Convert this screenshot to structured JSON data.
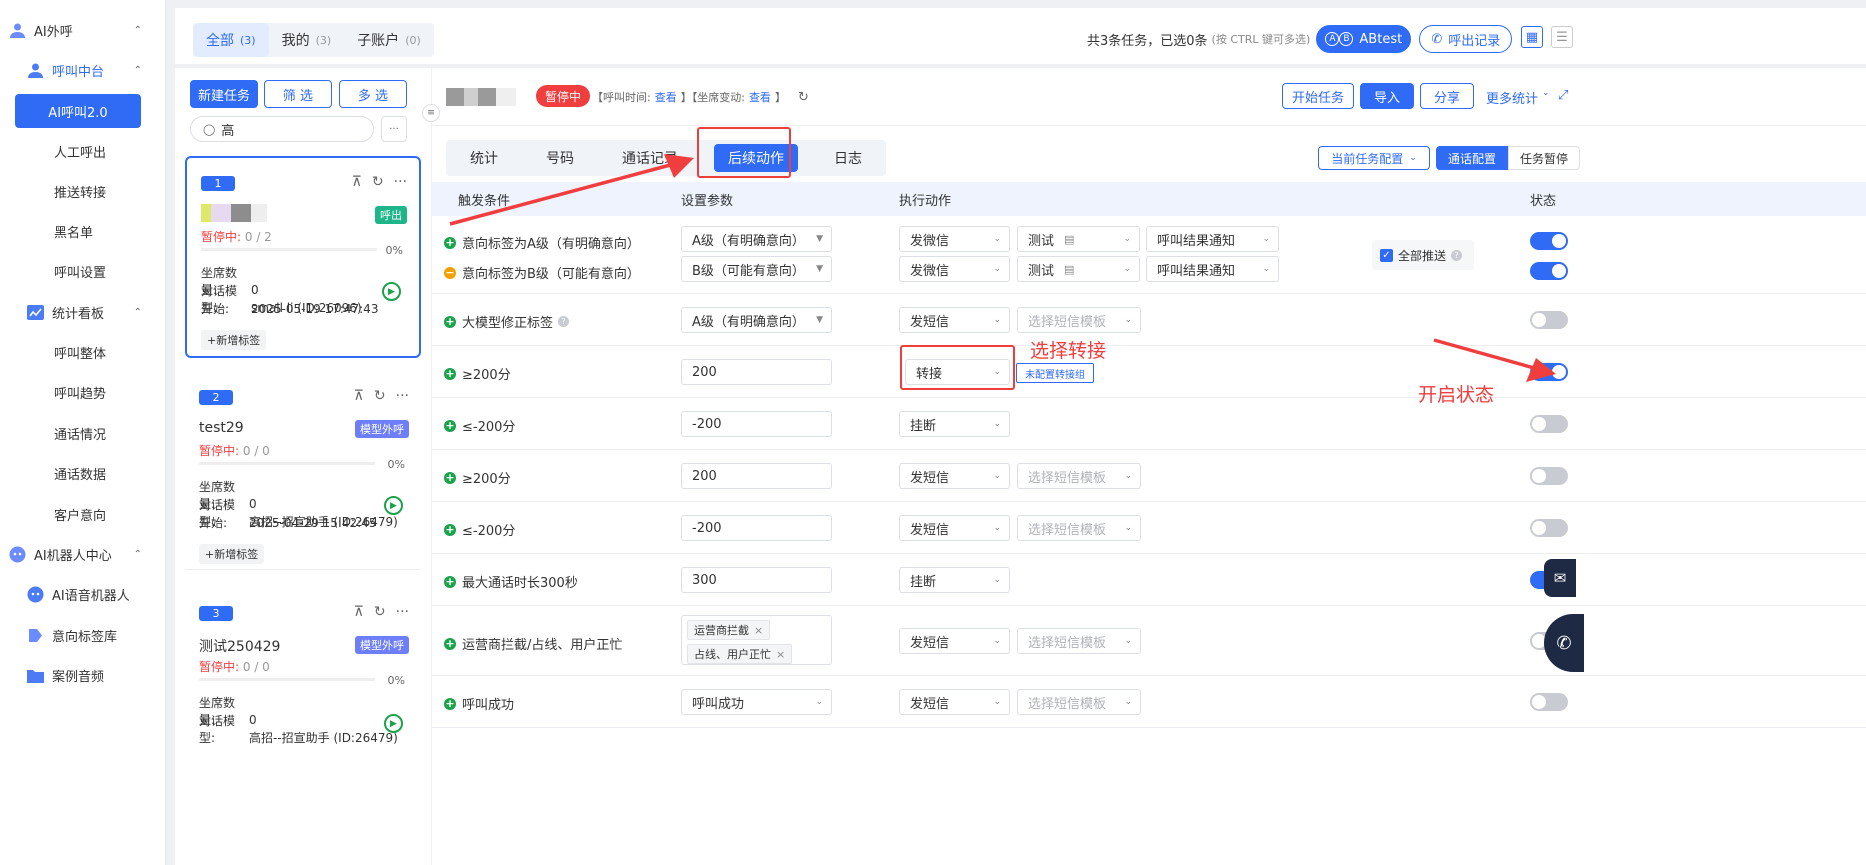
{
  "sidebar": {
    "ai_outbound": "AI外呼",
    "call_center": "呼叫中台",
    "ai_call": "AI呼叫2.0",
    "manual_call": "人工呼出",
    "push_transfer": "推送转接",
    "blacklist": "黑名单",
    "call_settings": "呼叫设置",
    "stats_board": "统计看板",
    "call_overall": "呼叫整体",
    "call_trend": "呼叫趋势",
    "call_status": "通话情况",
    "call_data": "通话数据",
    "customer_intent": "客户意向",
    "robot_center": "AI机器人中心",
    "voice_robot": "AI语音机器人",
    "intent_lib": "意向标签库",
    "case_audio": "案例音频"
  },
  "top_tabs": [
    {
      "label": "全部",
      "count": "(3)"
    },
    {
      "label": "我的",
      "count": "(3)"
    },
    {
      "label": "子账户",
      "count": "(0)"
    }
  ],
  "top_info": {
    "summary": "共3条任务，已选0条",
    "hint": "(按 CTRL 键可多选)",
    "abtest": "ABtest",
    "ab_a": "A",
    "ab_b": "B",
    "call_records": "呼出记录"
  },
  "left_toolbar": {
    "new_task": "新建任务",
    "filter": "筛 选",
    "multi": "多 选",
    "search_value": "高",
    "more": "···"
  },
  "cards": [
    {
      "num": "1",
      "title": "",
      "tag": "呼出",
      "status_paused": "暂停中:",
      "status_count": "0 / 2",
      "pct": "0%",
      "seats_label": "坐席数量:",
      "seats": "0",
      "model_label": "对话模型:",
      "model": "small li (ID:26096)",
      "start_label": "开始:",
      "start": "2025-05-19 17:47:43",
      "add_tag": "+新增标签"
    },
    {
      "num": "2",
      "title": "test29",
      "tag": "模型外呼",
      "status_paused": "暂停中:",
      "status_count": "0 / 0",
      "pct": "0%",
      "seats_label": "坐席数量:",
      "seats": "0",
      "model_label": "对话模型:",
      "model": "高招--招宣助手 (ID:26479)",
      "start_label": "开始:",
      "start": "2025-04-29 15:42:45",
      "add_tag": "+新增标签"
    },
    {
      "num": "3",
      "title": "测试250429",
      "tag": "模型外呼",
      "status_paused": "暂停中:",
      "status_count": "0 / 0",
      "pct": "0%",
      "seats_label": "坐席数量:",
      "seats": "0",
      "model_label": "对话模型:",
      "model": "高招--招宣助手 (ID:26479)"
    }
  ],
  "header": {
    "status": "暂停中",
    "call_time_label": "【呼叫时间:",
    "view1": "查看",
    "seat_change_label": "】【坐席变动:",
    "view2": "查看",
    "close": "】",
    "start_task": "开始任务",
    "import": "导入",
    "share": "分享",
    "more_stats": "更多统计"
  },
  "sub_tabs": [
    "统计",
    "号码",
    "通话记录",
    "后续动作",
    "日志"
  ],
  "config": {
    "current": "当前任务配置",
    "call_cfg": "通话配置",
    "pause_cfg": "任务暂停"
  },
  "table_head": {
    "trigger": "触发条件",
    "params": "设置参数",
    "action": "执行动作",
    "status": "状态"
  },
  "rows": [
    {
      "conds": [
        "意向标签为A级（有明确意向）",
        "意向标签为B级（可能有意向）"
      ],
      "params": [
        "A级（有明确意向）",
        "B级（可能有意向）"
      ],
      "actions": [
        "发微信",
        "发微信"
      ],
      "sub1": [
        "测试",
        "测试"
      ],
      "sub2": [
        "呼叫结果通知",
        "呼叫结果通知"
      ],
      "push_all": "全部推送"
    },
    {
      "cond": "大模型修正标签",
      "param": "A级（有明确意向）",
      "action": "发短信",
      "template": "选择短信模板"
    },
    {
      "cond": "≥200分",
      "param": "200",
      "action": "转接",
      "transfer": "未配置转接组"
    },
    {
      "cond": "≤-200分",
      "param": "-200",
      "action": "挂断"
    },
    {
      "cond": "≥200分",
      "param": "200",
      "action": "发短信",
      "template": "选择短信模板"
    },
    {
      "cond": "≤-200分",
      "param": "-200",
      "action": "发短信",
      "template": "选择短信模板"
    },
    {
      "cond": "最大通话时长300秒",
      "param": "300",
      "action": "挂断"
    },
    {
      "cond": "运营商拦截/占线、用户正忙",
      "chips": [
        "运营商拦截",
        "占线、用户正忙"
      ],
      "action": "发短信",
      "template": "选择短信模板"
    },
    {
      "cond": "呼叫成功",
      "param": "呼叫成功",
      "action": "发短信",
      "template": "选择短信模板"
    }
  ],
  "toggles": [
    true,
    true,
    false,
    true,
    false,
    false,
    false,
    true,
    false,
    false
  ],
  "annotations": {
    "select_transfer": "选择转接",
    "enable_status": "开启状态"
  }
}
